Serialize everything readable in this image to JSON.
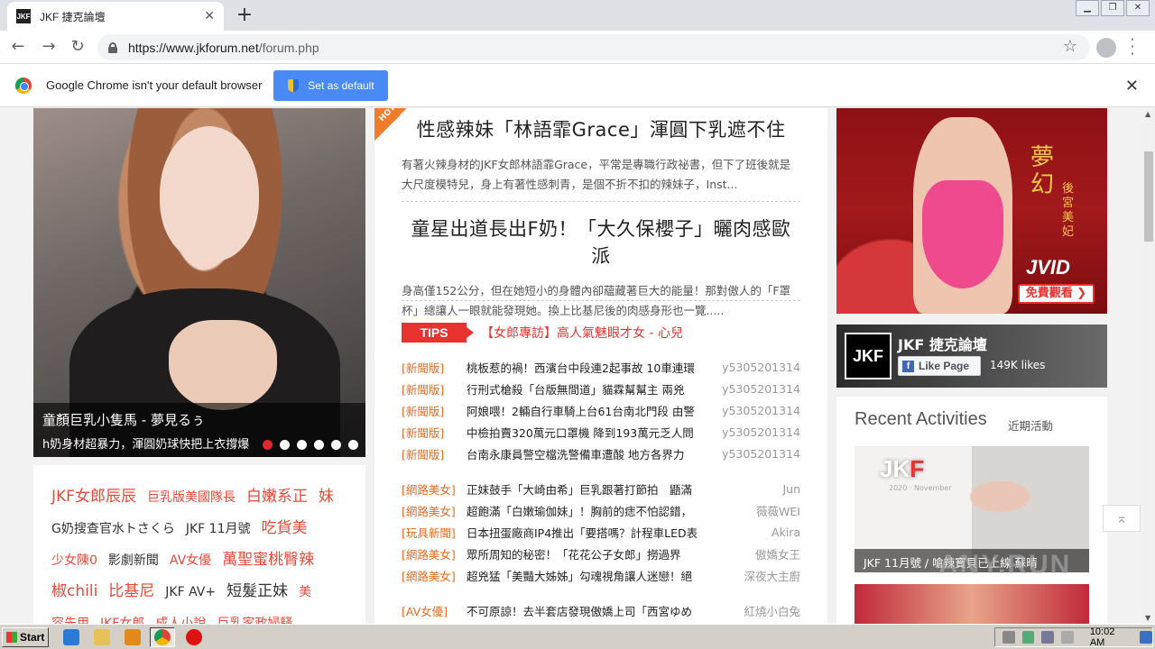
{
  "browser": {
    "tab_title": "JKF 捷克論壇",
    "tab_favicon": "JKF",
    "url_host": "https://www.jkforum.net",
    "url_path": "/forum.php",
    "infobar_text": "Google Chrome isn't your default browser",
    "infobar_button": "Set as default"
  },
  "hero": {
    "title": "童顏巨乳小隻馬 - 夢見るぅ",
    "subtitle": "h奶身材超暴力，渾圓奶球快把上衣撐爆",
    "slides": 6,
    "active_slide": 0
  },
  "tags": [
    {
      "text": "JKF女郎辰辰",
      "color": "red",
      "size": "big"
    },
    {
      "text": "巨乳版美國隊長",
      "color": "red",
      "size": "sm"
    },
    {
      "text": "白嫩系正",
      "color": "red",
      "size": "big"
    },
    {
      "text": "妹",
      "color": "red",
      "size": "big"
    },
    {
      "text": "G奶搜查官水トさくら",
      "color": "dark",
      "size": "sm"
    },
    {
      "text": "JKF 11月號",
      "color": "dark",
      "size": "sm"
    },
    {
      "text": "吃貨美",
      "color": "red",
      "size": "big"
    },
    {
      "text": "少女陳0",
      "color": "red",
      "size": "sm"
    },
    {
      "text": "影劇新聞",
      "color": "dark",
      "size": "sm"
    },
    {
      "text": "AV女優",
      "color": "red",
      "size": "sm"
    },
    {
      "text": "萬聖蜜桃臀辣",
      "color": "red",
      "size": "big"
    },
    {
      "text": "椒chili",
      "color": "red",
      "size": "big"
    },
    {
      "text": "比基尼",
      "color": "red",
      "size": "big"
    },
    {
      "text": "JKF AV+",
      "color": "dark",
      "size": "sm"
    },
    {
      "text": "短髮正妹",
      "color": "dark",
      "size": "big"
    },
    {
      "text": "美",
      "color": "red",
      "size": "sm"
    },
    {
      "text": "容先用",
      "color": "red",
      "size": "sm"
    },
    {
      "text": "JKF女郎",
      "color": "red",
      "size": "sm"
    },
    {
      "text": "成人小說",
      "color": "red",
      "size": "sm"
    },
    {
      "text": "巨乳家政婦騷",
      "color": "red",
      "size": "sm"
    }
  ],
  "hot_label": "HOT",
  "articles": [
    {
      "title": "性感辣妹「林語霏Grace」渾圓下乳遮不住",
      "body": "有著火辣身材的JKF女郎林語霏Grace，平常是專職行政祕書，但下了班後就是大尺度模特兒，身上有著性感刺青，是個不折不扣的辣妹子，Inst..."
    },
    {
      "title": "童星出道長出F奶！「大久保櫻子」曬肉感歐派",
      "body": "身高僅152公分，但在她短小的身體內卻蘊藏著巨大的能量！那對傲人的「F罩杯」總讓人一眼就能發現她。換上比基尼後的肉感身形也一覽....."
    }
  ],
  "tips": {
    "badge": "TIPS",
    "link": "【女郎專訪】高人氣魅眼才女 - 心兒"
  },
  "news_group1": [
    {
      "cat": "[新聞版]",
      "title": "桃板惹的禍！西濱台中段連2起事故 10車連環",
      "author": "y5305201314"
    },
    {
      "cat": "[新聞版]",
      "title": "行刑式槍殺「台版無間道」貓霖幫幫主 兩兇",
      "author": "y5305201314"
    },
    {
      "cat": "[新聞版]",
      "title": "阿娘喂！2輛自行車騎上台61台南北門段 由警",
      "author": "y5305201314"
    },
    {
      "cat": "[新聞版]",
      "title": "中檢拍賣320萬元口罩機 降到193萬元乏人問",
      "author": "y5305201314"
    },
    {
      "cat": "[新聞版]",
      "title": "台南永康員警空檔洗警備車遭酸 地方各界力",
      "author": "y5305201314"
    }
  ],
  "news_group2": [
    {
      "cat": "[網路美女]",
      "title": "正妹鼓手「大崎由希」巨乳跟著打節拍　鼯滿",
      "author": "Jun"
    },
    {
      "cat": "[網路美女]",
      "title": "超飽滿「白嫩瑜伽妹」！胸前的痣不怕認錯，",
      "author": "薇薇WEI"
    },
    {
      "cat": "[玩具新聞]",
      "title": "日本扭蛋廠商IP4推出「要搭嗎？計程車LED表",
      "author": "Akira"
    },
    {
      "cat": "[網路美女]",
      "title": "眾所周知的秘密！「花花公子女郎」撈過界",
      "author": "傲嬌女王"
    },
    {
      "cat": "[網路美女]",
      "title": "超兇猛「美豔大姊姊」勾魂視角讓人迷戀！絕",
      "author": "深夜大主廚"
    }
  ],
  "news_group3": [
    {
      "cat": "[AV女優]",
      "title": "不可原諒！去半套店發現傲嬌上司「西宮ゆめ",
      "author": "紅燒小白兔"
    }
  ],
  "ad": {
    "title": "夢幻",
    "subtitle": "後宮美妃",
    "brand": "JVID",
    "cta": "免費觀看 ❯"
  },
  "facebook": {
    "logo": "JKF",
    "name": "JKF 捷克論壇",
    "like_label": "Like Page",
    "likes": "149K likes"
  },
  "recent": {
    "title": "Recent Activities",
    "subtitle": "近期活動",
    "card_brand": "JKF",
    "card_date": "2020 · November",
    "card_caption": "JKF 11月號 / 嗆辣寶貝已上線 蘇晴"
  },
  "watermark": "ANY.RUN",
  "taskbar": {
    "start": "Start",
    "clock": "10:02 AM"
  },
  "colors": {
    "accent_red": "#e8322f",
    "chrome_blue": "#4a8af4",
    "category_orange": "#e86a1e"
  }
}
